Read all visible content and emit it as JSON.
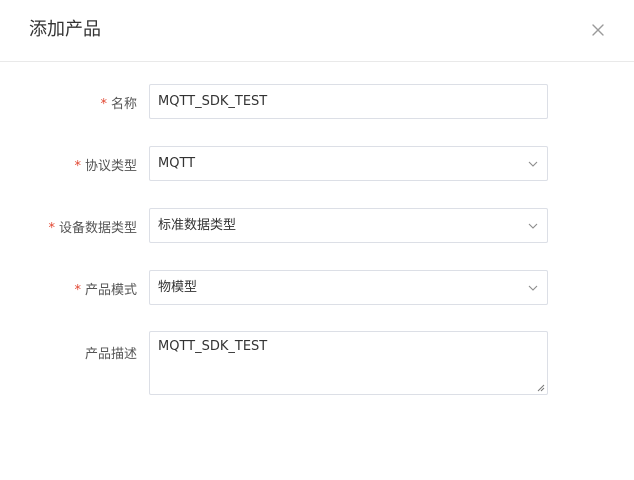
{
  "dialog": {
    "title": "添加产品"
  },
  "form": {
    "name": {
      "required_mark": "*",
      "label": "名称",
      "value": "MQTT_SDK_TEST"
    },
    "protocol_type": {
      "required_mark": "*",
      "label": "协议类型",
      "value": "MQTT"
    },
    "device_data_type": {
      "required_mark": "*",
      "label": "设备数据类型",
      "value": "标准数据类型"
    },
    "product_mode": {
      "required_mark": "*",
      "label": "产品模式",
      "value": "物模型"
    },
    "product_description": {
      "label": "产品描述",
      "value": "MQTT_SDK_TEST"
    }
  },
  "icons": {
    "close": "close-icon",
    "dropdown": "chevron-down-icon",
    "resize": "resize-handle-icon"
  },
  "colors": {
    "required": "#e1442f",
    "border": "#dcdfe6",
    "divider": "#e9e9e9",
    "text": "#333333",
    "label": "#555555"
  }
}
